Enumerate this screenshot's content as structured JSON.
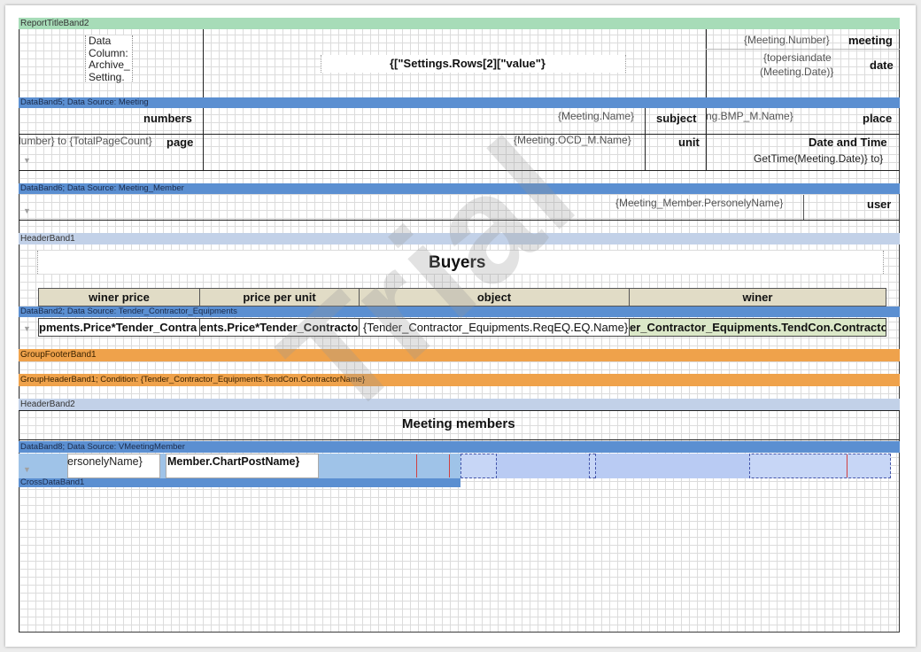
{
  "bands": {
    "report_title": "ReportTitleBand2",
    "data5": "DataBand5; Data Source: Meeting",
    "data6": "DataBand6; Data Source: Meeting_Member",
    "header1": "HeaderBand1",
    "data2": "DataBand2; Data Source: Tender_Contractor_Equipments",
    "group_footer": "GroupFooterBand1",
    "group_header": "GroupHeaderBand1; Condition: {Tender_Contractor_Equipments.TendCon.ContractorName}",
    "header2": "HeaderBand2",
    "data8": "DataBand8; Data Source: VMeetingMember",
    "cross": "CrossDataBand1"
  },
  "title_band": {
    "data_column_lines": [
      "Data",
      "Column:",
      "Archive_",
      "Setting."
    ],
    "settings_expr": "{[\"Settings.Rows[2][\"value\"}",
    "meeting_number_expr": "{Meeting.Number}",
    "meeting_label": "meeting",
    "topersiandate_expr": "{topersiandate",
    "meeting_date_expr": "(Meeting.Date)}",
    "date_label": "date"
  },
  "meeting_band": {
    "numbers_label": "numbers",
    "meeting_name_expr": "{Meeting.Name}",
    "subject_label": "subject",
    "bmp_name_expr": "ng.BMP_M.Name}",
    "place_label": "place",
    "page_number_expr": "lumber} to {TotalPageCount}",
    "page_label": "page",
    "ocd_name_expr": "{Meeting.OCD_M.Name}",
    "unit_label": "unit",
    "datetime_label": "Date and Time",
    "gettime_expr": "GetTime(Meeting.Date)} to}"
  },
  "member_band": {
    "personely_expr": "{Meeting_Member.PersonelyName}",
    "user_label": "user"
  },
  "buyers_title": "Buyers",
  "table_headers": [
    "winer price",
    "price per unit",
    "object",
    "winer"
  ],
  "table_row": [
    "pments.Price*Tender_Contra",
    "ents.Price*Tender_Contracto",
    "{Tender_Contractor_Equipments.ReqEQ.EQ.Name}",
    "er_Contractor_Equipments.TendCon.Contractor."
  ],
  "members_title": "Meeting members",
  "members_row": {
    "personely_expr": "ersonelyName}",
    "chart_post_expr": "Member.ChartPostName}"
  },
  "watermark": "Trial",
  "colors": {
    "title_band": "#a7dcb8",
    "data_band": "#5b8fd1",
    "header_band": "#c2d1e8",
    "group_band": "#efa24b",
    "table_header": "#e1dcc6",
    "highlight": "#dbe8c8"
  }
}
